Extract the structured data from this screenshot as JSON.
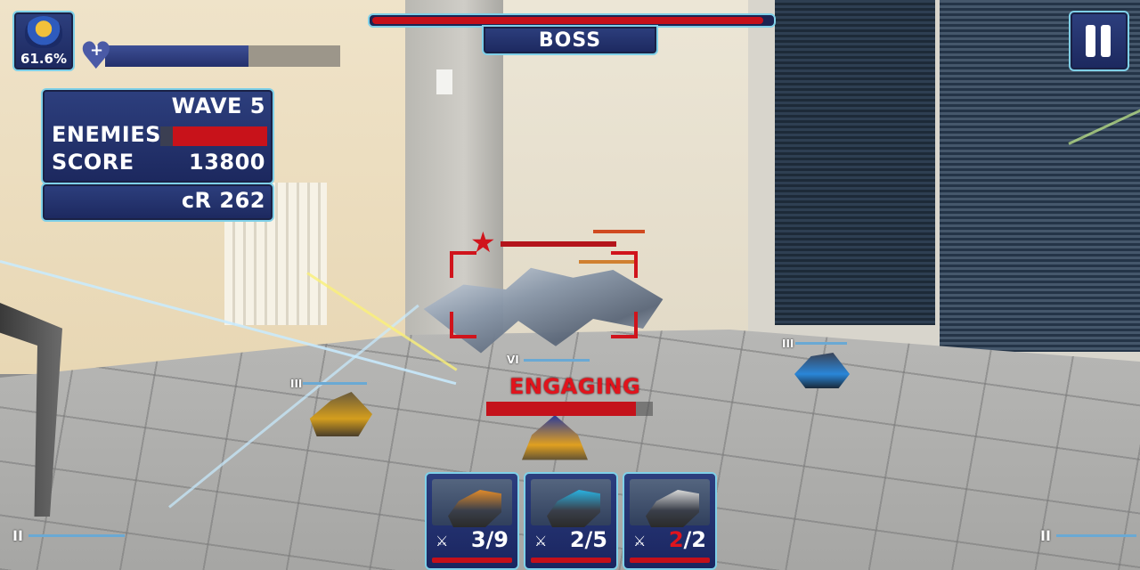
{
  "hud": {
    "player": {
      "percent": "61.6%",
      "health_fraction": 0.61
    },
    "stats": {
      "wave": "WAVE 5",
      "enemies_label": "ENEMIES",
      "enemies_fraction": 0.88,
      "score_label": "SCORE",
      "score_value": "13800",
      "credits": "cR 262"
    },
    "boss": {
      "label": "BOSS",
      "health_fraction": 0.98
    },
    "pause_icon": "pause-icon"
  },
  "battle": {
    "status_text": "ENGAGING",
    "engage_fraction": 0.9,
    "ranks": {
      "yellow_turret": "III",
      "blue_turret": "III",
      "center_turret": "VI",
      "bottom_left": "II",
      "bottom_right": "II"
    }
  },
  "build_cards": [
    {
      "name": "orange-turret",
      "accent": "#e08a2a",
      "used": "3",
      "total": "/9",
      "full": false
    },
    {
      "name": "cyan-turret",
      "accent": "#2ab2e0",
      "used": "2",
      "total": "/5",
      "full": false
    },
    {
      "name": "white-turret",
      "accent": "#d8d8d8",
      "used": "2",
      "total": "/2",
      "full": true
    }
  ],
  "colors": {
    "panel": "#1c285e",
    "panel_border": "#7fd0e8",
    "health_red": "#c4101a"
  }
}
